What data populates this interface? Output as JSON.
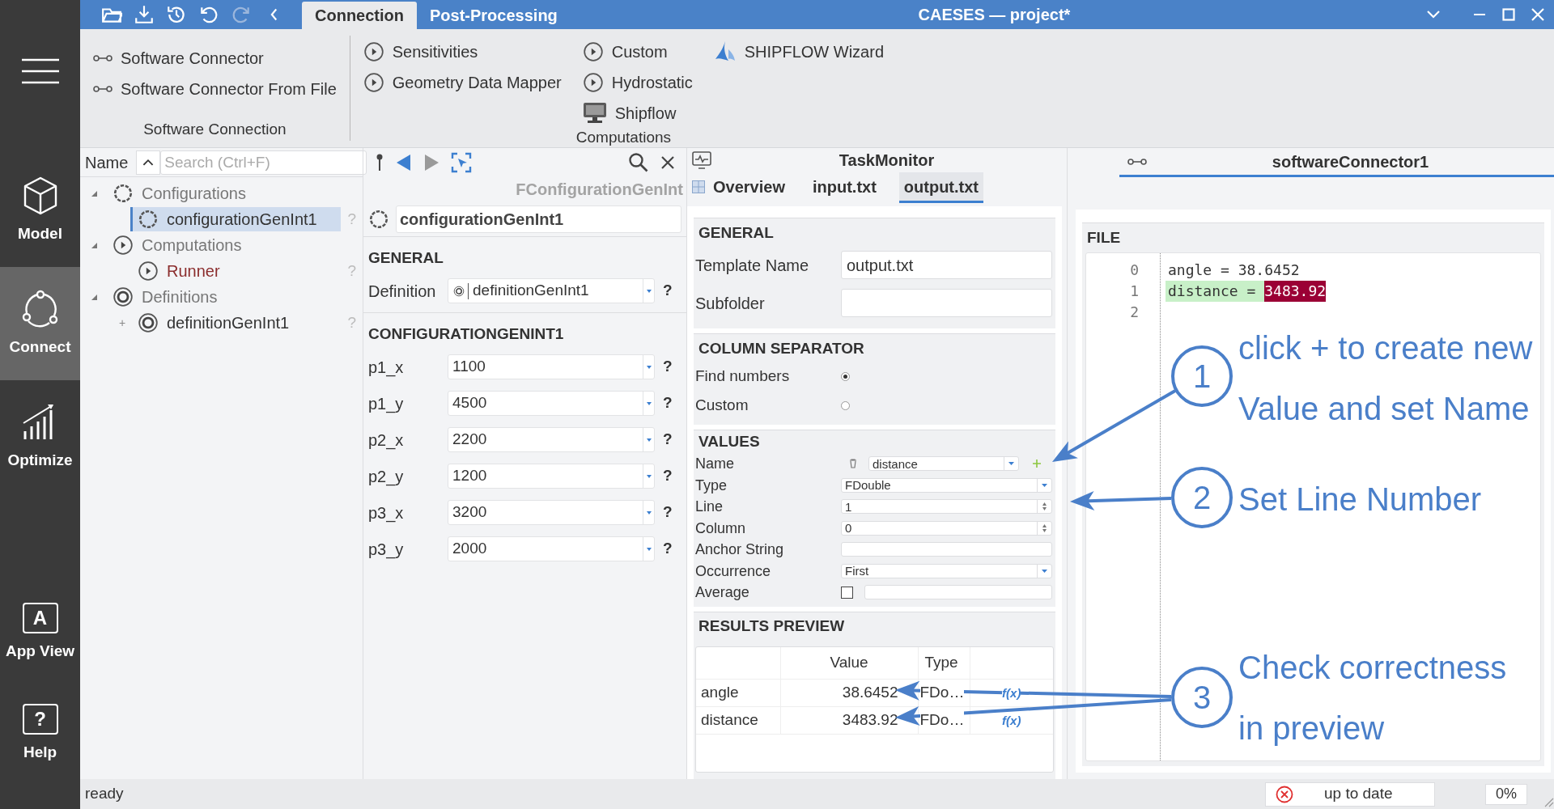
{
  "window": {
    "title": "CAESES — project*"
  },
  "quick_actions": [
    {
      "kind": "open",
      "disabled": false
    },
    {
      "kind": "save",
      "disabled": false
    },
    {
      "kind": "history",
      "disabled": false
    },
    {
      "kind": "undo",
      "disabled": false
    },
    {
      "kind": "redo",
      "disabled": true
    },
    {
      "kind": "back",
      "disabled": false
    }
  ],
  "ribbon_tabs": [
    {
      "label": "Connection",
      "selected": true
    },
    {
      "label": "Post-Processing",
      "selected": false
    }
  ],
  "ribbon_groups": [
    {
      "label": "Software Connection",
      "columns": [
        [
          {
            "kind": "connector",
            "label": "Software Connector"
          },
          {
            "kind": "connector",
            "label": "Software Connector From File"
          }
        ]
      ]
    },
    {
      "label": "Computations",
      "columns": [
        [
          {
            "kind": "computation",
            "label": "Sensitivities"
          },
          {
            "kind": "computation",
            "label": "Geometry Data Mapper"
          }
        ],
        [
          {
            "kind": "computation",
            "label": "Custom"
          },
          {
            "kind": "computation",
            "label": "Hydrostatic"
          },
          {
            "kind": "shipflow",
            "label": "Shipflow"
          }
        ],
        [
          {
            "kind": "wizard",
            "label": "SHIPFLOW Wizard"
          }
        ]
      ]
    }
  ],
  "sidebar": {
    "items": [
      {
        "kind": "model",
        "label": "Model",
        "selected": false
      },
      {
        "kind": "connect",
        "label": "Connect",
        "selected": true
      },
      {
        "kind": "optimize",
        "label": "Optimize",
        "selected": false
      },
      {
        "kind": "appview",
        "glyph": "A",
        "label": "App View",
        "selected": false
      },
      {
        "kind": "help",
        "glyph": "?",
        "label": "Help",
        "selected": false
      }
    ]
  },
  "tree": {
    "column": "Name",
    "search": {
      "placeholder": "Search (Ctrl+F)"
    },
    "items": [
      {
        "kind": "configuration",
        "label": "Configurations",
        "expanded": true,
        "children": [
          {
            "kind": "configuration",
            "label": "configurationGenInt1",
            "selected": true,
            "color": "#333333",
            "help": "?"
          }
        ]
      },
      {
        "kind": "computation",
        "label": "Computations",
        "expanded": true,
        "children": [
          {
            "kind": "computation",
            "label": "Runner",
            "selected": false,
            "color": "#8b2d2d",
            "help": "?"
          }
        ]
      },
      {
        "kind": "definition",
        "label": "Definitions",
        "expanded": true,
        "children": [
          {
            "kind": "definition",
            "label": "definitionGenInt1",
            "selected": false,
            "color": "#333333",
            "help": "?",
            "toggle": "+"
          }
        ]
      }
    ]
  },
  "properties": {
    "type": "FConfigurationGenInt",
    "name": "configurationGenInt1",
    "sections": [
      {
        "title": "GENERAL",
        "rows": [
          {
            "label": "Definition",
            "value": "definitionGenInt1",
            "help": "?"
          }
        ]
      },
      {
        "title": "CONFIGURATIONGENINT1",
        "rows": [
          {
            "label": "p1_x",
            "value": "1100",
            "help": "?"
          },
          {
            "label": "p1_y",
            "value": "4500",
            "help": "?"
          },
          {
            "label": "p2_x",
            "value": "2200",
            "help": "?"
          },
          {
            "label": "p2_y",
            "value": "1200",
            "help": "?"
          },
          {
            "label": "p3_x",
            "value": "3200",
            "help": "?"
          },
          {
            "label": "p3_y",
            "value": "2000",
            "help": "?"
          }
        ]
      }
    ]
  },
  "task_monitor": {
    "title": "TaskMonitor",
    "tabs": [
      {
        "label": "Overview",
        "selected": false
      },
      {
        "label": "input.txt",
        "selected": false
      },
      {
        "label": "output.txt",
        "selected": true
      }
    ],
    "general": {
      "title": "GENERAL",
      "rows": [
        {
          "label": "Template Name",
          "value": "output.txt"
        },
        {
          "label": "Subfolder"
        }
      ]
    },
    "column_separator": {
      "title": "COLUMN SEPARATOR",
      "options": [
        {
          "label": "Find numbers",
          "selected": true
        },
        {
          "label": "Custom",
          "selected": false
        }
      ]
    },
    "values": {
      "title": "VALUES",
      "rows": [
        {
          "kind": "name",
          "label": "Name",
          "value": "distance"
        },
        {
          "kind": "combo",
          "label": "Type",
          "value": "FDouble"
        },
        {
          "kind": "spin",
          "label": "Line",
          "value": "1"
        },
        {
          "kind": "spin",
          "label": "Column",
          "value": "0"
        },
        {
          "kind": "text",
          "label": "Anchor String"
        },
        {
          "kind": "combo",
          "label": "Occurrence",
          "value": "First"
        },
        {
          "kind": "check",
          "label": "Average",
          "checked": false
        }
      ]
    },
    "results": {
      "title": "RESULTS PREVIEW",
      "columns": [
        "Value",
        "Type"
      ],
      "rows": [
        {
          "name": "angle",
          "value": "38.6452",
          "type": "FDo…",
          "action": "f(x)"
        },
        {
          "name": "distance",
          "value": "3483.92",
          "type": "FDo…",
          "action": "f(x)"
        }
      ]
    }
  },
  "file_panel": {
    "title": "softwareConnector1",
    "section": "FILE",
    "lines": [
      {
        "number": "0",
        "text": "angle = 38.6452",
        "highlight": false
      },
      {
        "number": "1",
        "text": "distance = ",
        "match": "3483.92",
        "highlight": true
      },
      {
        "number": "2"
      }
    ]
  },
  "annotations": [
    {
      "number": "1",
      "lines": [
        "click + to create new",
        "Value and set Name"
      ]
    },
    {
      "number": "2",
      "lines": [
        "Set Line Number"
      ]
    },
    {
      "number": "3",
      "lines": [
        "Check correctness",
        "in preview"
      ]
    }
  ],
  "status_bar": {
    "message": "ready",
    "state": "up to date",
    "progress": "0%"
  }
}
